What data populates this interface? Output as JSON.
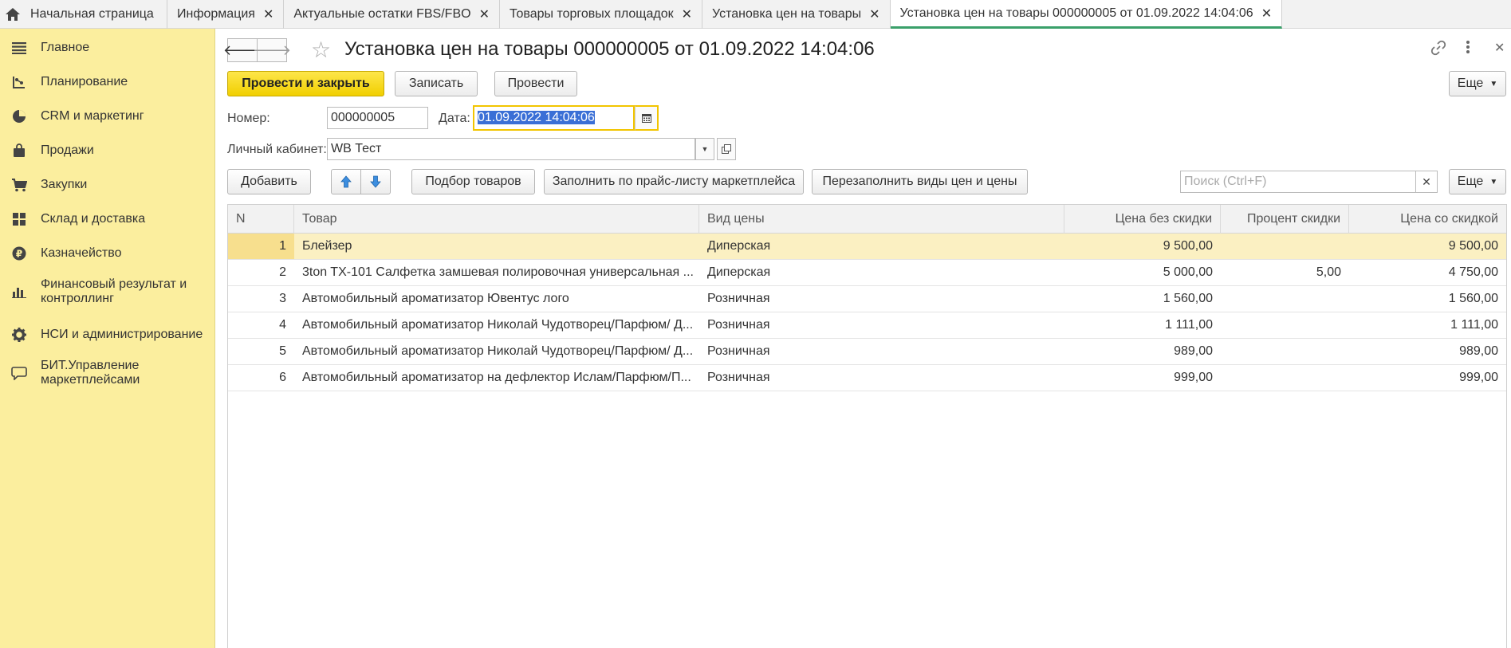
{
  "tabs": [
    {
      "label": "Начальная страница"
    },
    {
      "label": "Информация"
    },
    {
      "label": "Актуальные остатки FBS/FBO"
    },
    {
      "label": "Товары торговых площадок"
    },
    {
      "label": "Установка цен на товары"
    },
    {
      "label": "Установка цен на товары 000000005 от 01.09.2022 14:04:06"
    }
  ],
  "close_glyph": "✕",
  "sidebar": {
    "items": [
      {
        "label": "Главное",
        "icon": "menu-icon"
      },
      {
        "label": "Планирование",
        "icon": "planning-icon"
      },
      {
        "label": "CRM и маркетинг",
        "icon": "pie-chart-icon"
      },
      {
        "label": "Продажи",
        "icon": "bag-icon"
      },
      {
        "label": "Закупки",
        "icon": "cart-icon"
      },
      {
        "label": "Склад и доставка",
        "icon": "warehouse-icon"
      },
      {
        "label": "Казначейство",
        "icon": "ruble-icon"
      },
      {
        "label": "Финансовый результат и контроллинг",
        "icon": "bar-chart-icon"
      },
      {
        "label": "НСИ и администрирование",
        "icon": "gear-icon"
      },
      {
        "label": "БИТ.Управление маркетплейсами",
        "icon": "chat-icon"
      }
    ]
  },
  "header": {
    "title": "Установка цен на товары 000000005 от 01.09.2022 14:04:06"
  },
  "toolbar": {
    "post_close": "Провести и закрыть",
    "save": "Записать",
    "post": "Провести",
    "more": "Еще"
  },
  "form": {
    "number_label": "Номер:",
    "number_value": "000000005",
    "date_label": "Дата:",
    "date_value": "01.09.2022 14:04:06",
    "cabinet_label": "Личный кабинет:",
    "cabinet_value": "WB Тест"
  },
  "table_toolbar": {
    "add": "Добавить",
    "pick": "Подбор товаров",
    "fill_price": "Заполнить по прайс-листу маркетплейса",
    "refill": "Перезаполнить виды цен и цены",
    "search_placeholder": "Поиск (Ctrl+F)",
    "more": "Еще"
  },
  "table": {
    "columns": [
      "N",
      "Товар",
      "Вид цены",
      "Цена без скидки",
      "Процент скидки",
      "Цена со скидкой"
    ],
    "rows": [
      {
        "n": "1",
        "product": "Блейзер",
        "price_type": "Диперская",
        "price": "9 500,00",
        "discount": "",
        "final": "9 500,00"
      },
      {
        "n": "2",
        "product": "3ton TX-101 Салфетка замшевая полировочная универсальная ...",
        "price_type": "Диперская",
        "price": "5 000,00",
        "discount": "5,00",
        "final": "4 750,00"
      },
      {
        "n": "3",
        "product": "Автомобильный ароматизатор Ювентус лого",
        "price_type": "Розничная",
        "price": "1 560,00",
        "discount": "",
        "final": "1 560,00"
      },
      {
        "n": "4",
        "product": "Автомобильный ароматизатор Николай Чудотворец/Парфюм/ Д...",
        "price_type": "Розничная",
        "price": "1 111,00",
        "discount": "",
        "final": "1 111,00"
      },
      {
        "n": "5",
        "product": "Автомобильный ароматизатор Николай Чудотворец/Парфюм/ Д...",
        "price_type": "Розничная",
        "price": "989,00",
        "discount": "",
        "final": "989,00"
      },
      {
        "n": "6",
        "product": "Автомобильный ароматизатор на дефлектор Ислам/Парфюм/П...",
        "price_type": "Розничная",
        "price": "999,00",
        "discount": "",
        "final": "999,00"
      }
    ]
  }
}
